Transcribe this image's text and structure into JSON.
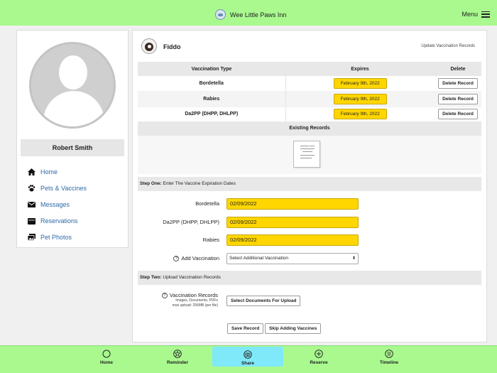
{
  "app": {
    "title": "Wee Little Paws Inn",
    "menu_label": "Menu"
  },
  "user": {
    "name": "Robert Smith"
  },
  "sidebar": {
    "items": [
      {
        "label": "Home",
        "icon": "home-icon"
      },
      {
        "label": "Pets & Vaccines",
        "icon": "paw-icon"
      },
      {
        "label": "Messages",
        "icon": "envelope-icon"
      },
      {
        "label": "Reservations",
        "icon": "calendar-icon"
      },
      {
        "label": "Pet Photos",
        "icon": "photo-icon"
      }
    ]
  },
  "pet": {
    "name": "Fiddo",
    "update_link": "Update Vaccination Records"
  },
  "vaccine_table": {
    "headers": {
      "type": "Vaccination Type",
      "expires": "Expires",
      "delete": "Delete"
    },
    "rows": [
      {
        "type": "Bordetella",
        "expires": "February 9th, 2022",
        "delete_label": "Delete Record"
      },
      {
        "type": "Rabies",
        "expires": "February 9th, 2022",
        "delete_label": "Delete Record"
      },
      {
        "type": "Da2PP (DHPP, DHLPP)",
        "expires": "February 9th, 2022",
        "delete_label": "Delete Record"
      }
    ],
    "existing_records_label": "Existing Records"
  },
  "step_one": {
    "title": "Step One:",
    "subtitle": "Enter The Vaccine Expiration Dates",
    "fields": [
      {
        "label": "Bordetella",
        "value": "02/09/2022"
      },
      {
        "label": "Da2PP (DHPP, DHLPP)",
        "value": "02/09/2022"
      },
      {
        "label": "Rabies",
        "value": "02/09/2022"
      }
    ],
    "add_vaccination": {
      "label": "Add Vaccination",
      "help": "?",
      "selected": "Select Additional Vaccination"
    }
  },
  "step_two": {
    "title": "Step Two:",
    "subtitle": "Upload Vaccination Records",
    "upload": {
      "label": "Vaccination Records",
      "help": "?",
      "sub1": "Images, Documents, PDFs",
      "sub2": "max upload: 256MB (per file)",
      "button": "Select Documents For Upload"
    },
    "save_label": "Save Record",
    "skip_label": "Skip Adding Vaccines"
  },
  "bottom_nav": [
    {
      "label": "Home",
      "icon": "circle-icon"
    },
    {
      "label": "Reminder",
      "icon": "star-icon"
    },
    {
      "label": "Share",
      "icon": "camera-icon",
      "active": true
    },
    {
      "label": "Reserve",
      "icon": "plus-circle-icon"
    },
    {
      "label": "Timeline",
      "icon": "timeline-icon"
    }
  ],
  "colors": {
    "bar_green": "#a9f98f",
    "active_tab": "#7fe9f9",
    "date_yellow": "#ffd600",
    "link_blue": "#2e6aa8"
  }
}
